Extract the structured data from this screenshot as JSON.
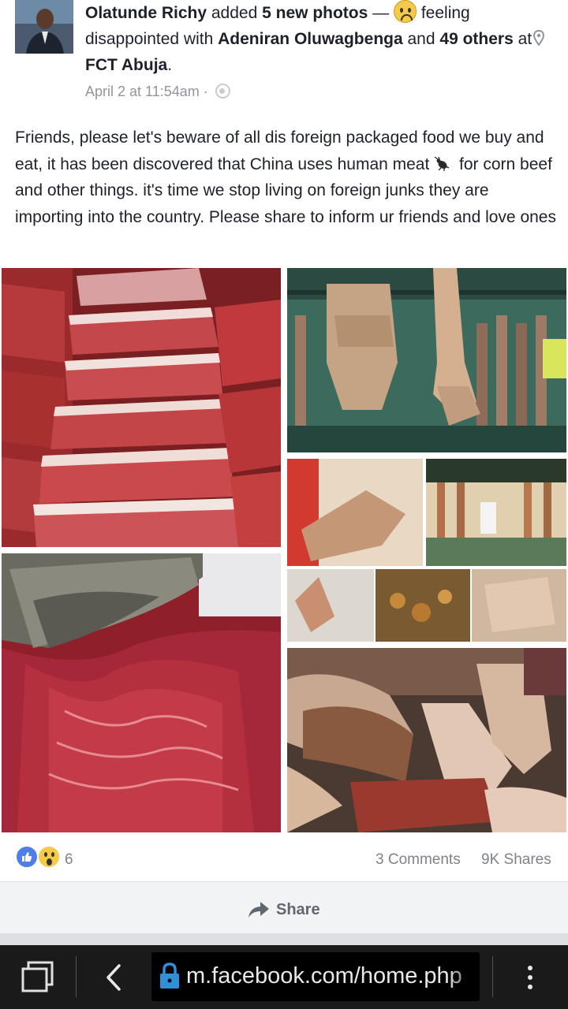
{
  "post": {
    "author": "Olatunde Richy",
    "action_text": "added",
    "photo_count": "5 new photos",
    "dash": "—",
    "feeling_text": "feeling disappointed with",
    "tagged_person": "Adeniran Oluwagbenga",
    "and_text": "and",
    "others": "49 others",
    "at_text": "at",
    "location": "FCT Abuja",
    "period": ".",
    "timestamp": "April 2 at 11:54am ·",
    "body_part1": "Friends, please let's beware of all dis foreign packaged food we buy and eat, it has been discovered that China uses human meat",
    "body_part2": "for corn beef and other things. it's time we stop living on foreign junks they are importing into the country. Please share to inform ur friends and love ones"
  },
  "reactions": {
    "count": "6",
    "comments": "3 Comments",
    "shares": "9K Shares",
    "like_icon": "like-icon",
    "wow_icon": "wow-icon"
  },
  "actions": {
    "share_label": "Share"
  },
  "browser": {
    "url": "m.facebook.com/home.php"
  },
  "colors": {
    "link_blue": "#4f7ee8",
    "meta_gray": "#90949c",
    "browser_bg": "#1a1a1a",
    "lock_blue": "#2f8fd8"
  }
}
